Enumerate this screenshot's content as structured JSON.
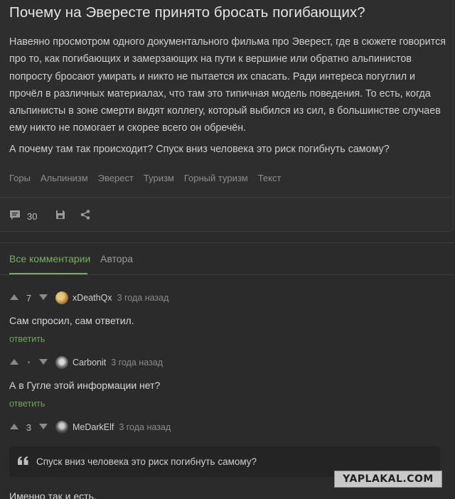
{
  "post": {
    "title": "Почему на Эвересте принято бросать погибающих?",
    "body": "Навеяно просмотром одного документального фильма про Эверест, где в сюжете говорится про то, как погибающих и замерзающих на пути к вершине или обратно альпинистов попросту бросают умирать и никто не пытается их спасать. Ради интереса погуглил и прочёл в различных материалах, что там это типичная модель поведения. То есть, когда альпинисты в зоне смерти видят коллегу, который выбился из сил, в большинстве случаев ему никто не помогает и скорее всего он обречён.",
    "question": "А почему там так происходит? Спуск вниз человека это риск погибнуть самому?",
    "tags": [
      "Горы",
      "Альпинизм",
      "Эверест",
      "Туризм",
      "Горный туризм",
      "Текст"
    ],
    "comments_count": "30",
    "icons": [
      "comment-icon",
      "save-icon",
      "share-icon"
    ]
  },
  "tabs": {
    "all": "Все комментарии",
    "author": "Автора"
  },
  "comments": [
    {
      "score": "7",
      "nick": "xDeathQx",
      "time": "3 года назад",
      "text": "Сам спросил, сам ответил.",
      "reply": "ответить"
    },
    {
      "score": "•",
      "nick": "Carbonit",
      "time": "3 года назад",
      "text": "А в Гугле этой информации нет?",
      "reply": "ответить"
    },
    {
      "score": "3",
      "nick": "MeDarkElf",
      "time": "3 года назад",
      "quote": "Спуск вниз человека это риск погибнуть самому?",
      "text": "Именно так и есть."
    }
  ],
  "watermark": "YAPLAKAL.COM",
  "colors": {
    "background": "#2b2b2b",
    "accent": "#75b05a",
    "text": "#d6d6d6",
    "muted": "#8e8e8e"
  }
}
